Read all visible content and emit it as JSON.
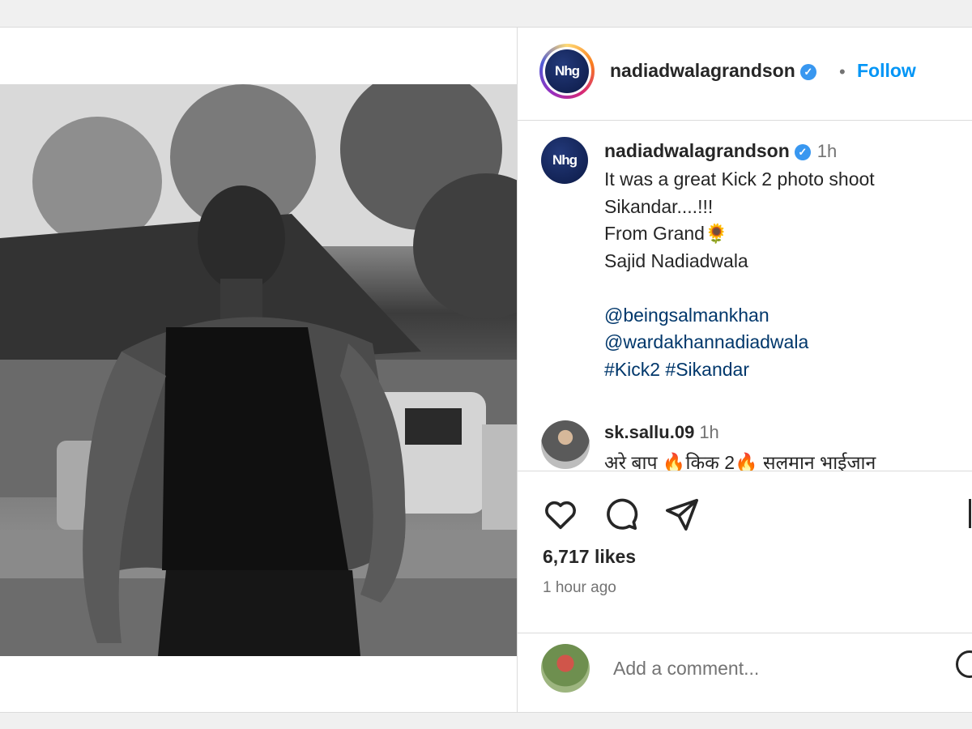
{
  "post": {
    "author": {
      "username": "nadiadwalagrandson",
      "logo_text": "Nhg",
      "verified": "✓"
    },
    "header": {
      "separator": "•",
      "follow_label": "Follow"
    },
    "caption": {
      "time": "1h",
      "lines": [
        "It was a great Kick 2 photo shoot",
        "Sikandar....!!!",
        "From Grand🌻",
        "Sajid Nadiadwala",
        "",
        "@beingsalmankhan",
        "@wardakhannadiadwala",
        "#Kick2 #Sikandar"
      ]
    },
    "comments": [
      {
        "username": "sk.sallu.09",
        "time": "1h",
        "text": "अरे बाप 🔥किक 2🔥 सलमान भाईजान"
      }
    ],
    "actions": {
      "likes": "6,717 likes",
      "time_ago": "1 hour ago"
    },
    "add_comment": {
      "placeholder": "Add a comment..."
    },
    "icons": [
      "heart-icon",
      "comment-icon",
      "share-icon",
      "save-icon",
      "emoji-icon"
    ],
    "colors": {
      "accent": "#0095f6",
      "verified": "#3897f0",
      "text": "#262626",
      "muted": "#737373",
      "border": "#dbdbdb"
    }
  }
}
